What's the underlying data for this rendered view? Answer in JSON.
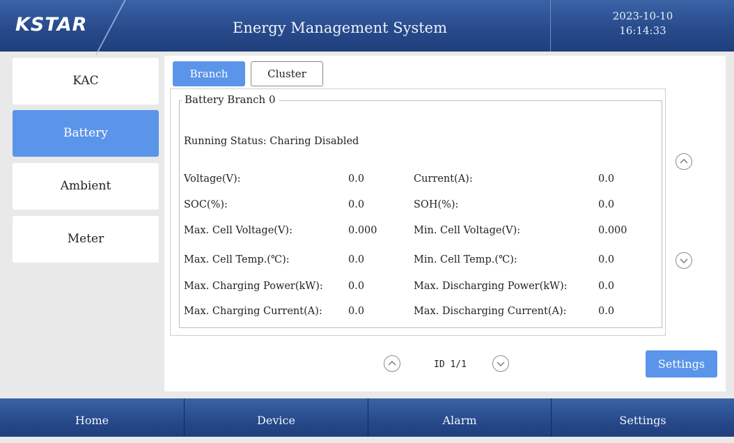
{
  "header": {
    "logo": "KSTAR",
    "title": "Energy Management System",
    "date": "2023-10-10",
    "time": "16:14:33"
  },
  "sidebar": {
    "items": [
      {
        "label": "KAC",
        "active": false
      },
      {
        "label": "Battery",
        "active": true
      },
      {
        "label": "Ambient",
        "active": false
      },
      {
        "label": "Meter",
        "active": false
      }
    ]
  },
  "tabs": {
    "branch": "Branch",
    "cluster": "Cluster",
    "active": "Branch"
  },
  "branch": {
    "legend": "Battery Branch 0",
    "status": "Running Status: Charing Disabled",
    "left": [
      {
        "label": "Voltage(V):",
        "value": "0.0"
      },
      {
        "label": "SOC(%):",
        "value": "0.0"
      },
      {
        "label": "Max. Cell Voltage(V):",
        "value": "0.000"
      },
      {
        "label": "Max. Cell Temp.(℃):",
        "value": "0.0"
      },
      {
        "label": "Max. Charging Power(kW):",
        "value": "0.0"
      },
      {
        "label": "Max. Charging Current(A):",
        "value": "0.0"
      }
    ],
    "right": [
      {
        "label": "Current(A):",
        "value": "0.0"
      },
      {
        "label": "SOH(%):",
        "value": "0.0"
      },
      {
        "label": "Min. Cell Voltage(V):",
        "value": "0.000"
      },
      {
        "label": "Min. Cell Temp.(℃):",
        "value": "0.0"
      },
      {
        "label": "Max. Discharging Power(kW):",
        "value": "0.0"
      },
      {
        "label": "Max. Discharging Current(A):",
        "value": "0.0"
      }
    ]
  },
  "pager": {
    "label": "ID 1/1"
  },
  "settings_button": "Settings",
  "icons": {
    "scroll_up": "chevron-up-circle-icon",
    "scroll_down": "chevron-down-circle-icon"
  },
  "colors": {
    "header_blue": "#27498a",
    "accent": "#5b95ea"
  },
  "bottom_nav": {
    "items": [
      "Home",
      "Device",
      "Alarm",
      "Settings"
    ]
  }
}
